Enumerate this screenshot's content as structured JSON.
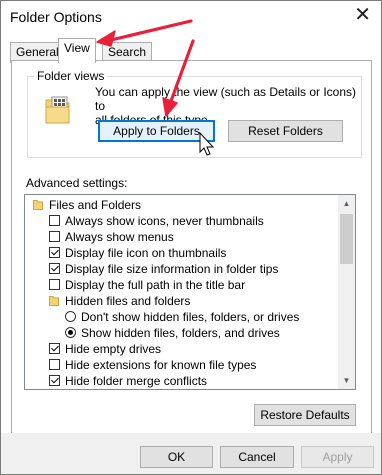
{
  "window": {
    "title": "Folder Options",
    "close_glyph": "✕"
  },
  "tabs": [
    {
      "label": "General"
    },
    {
      "label": "View",
      "active": true
    },
    {
      "label": "Search"
    }
  ],
  "folder_views": {
    "label": "Folder views",
    "description_line1": "You can apply the view (such as Details or Icons) to",
    "description_line2": "all folders of this type.",
    "apply_button": "Apply to Folders",
    "reset_button": "Reset Folders"
  },
  "advanced": {
    "label": "Advanced settings:",
    "items": [
      {
        "type": "folder",
        "label": "Files and Folders",
        "indent": 0
      },
      {
        "type": "checkbox",
        "label": "Always show icons, never thumbnails",
        "checked": false,
        "indent": 1
      },
      {
        "type": "checkbox",
        "label": "Always show menus",
        "checked": false,
        "indent": 1
      },
      {
        "type": "checkbox",
        "label": "Display file icon on thumbnails",
        "checked": true,
        "indent": 1
      },
      {
        "type": "checkbox",
        "label": "Display file size information in folder tips",
        "checked": true,
        "indent": 1
      },
      {
        "type": "checkbox",
        "label": "Display the full path in the title bar",
        "checked": false,
        "indent": 1
      },
      {
        "type": "folder",
        "label": "Hidden files and folders",
        "indent": 1
      },
      {
        "type": "radio",
        "label": "Don't show hidden files, folders, or drives",
        "checked": false,
        "indent": 2
      },
      {
        "type": "radio",
        "label": "Show hidden files, folders, and drives",
        "checked": true,
        "indent": 2
      },
      {
        "type": "checkbox",
        "label": "Hide empty drives",
        "checked": true,
        "indent": 1
      },
      {
        "type": "checkbox",
        "label": "Hide extensions for known file types",
        "checked": false,
        "indent": 1
      },
      {
        "type": "checkbox",
        "label": "Hide folder merge conflicts",
        "checked": true,
        "indent": 1
      }
    ],
    "restore_button": "Restore Defaults"
  },
  "footer": {
    "ok": "OK",
    "cancel": "Cancel",
    "apply": "Apply"
  },
  "colors": {
    "annotation_arrow": "#e8203a",
    "focus_blue": "#0078d7"
  }
}
